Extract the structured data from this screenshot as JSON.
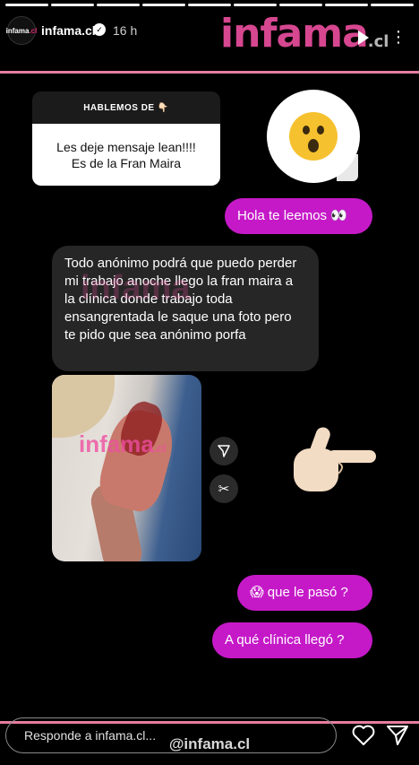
{
  "progress": {
    "segments": 9
  },
  "header": {
    "avatar_text_a": "infama",
    "avatar_text_b": ".cl",
    "username": "infama.cl",
    "verified_icon": "verified-check-icon",
    "time": "16 h",
    "brand_logo": "infama",
    "brand_suffix": ".cl",
    "play_icon": "play-icon",
    "more_icon": "more-icon"
  },
  "question_sticker": {
    "title": "HABLEMOS DE 👇🏻",
    "line1": "Les deje mensaje lean!!!!",
    "line2": "Es de la Fran Maira"
  },
  "reaction_emoji": "astonished-face",
  "messages": [
    {
      "text": "Hola te leemos 👀"
    },
    {
      "text": "Todo anónimo podrá que puedo perder mi trabajo anoche llego la fran maira a la clínica donde trabajo toda ensangrentada le saque una foto pero te pido que sea anónimo porfa"
    },
    {
      "text": "😱 que le pasó ?"
    },
    {
      "text": "A qué clínica llegó ?"
    }
  ],
  "watermarks": {
    "mid": "infama",
    "photo": "infama",
    "photo_suffix": ".cl",
    "bottom": "@infama.cl"
  },
  "reply_bar": {
    "placeholder": "Responde a infama.cl..."
  },
  "colors": {
    "accent_pink": "#c519c8",
    "brand_pink": "#ee4fa0",
    "band_pink": "#e67e9f",
    "grey_bubble": "#262626"
  }
}
